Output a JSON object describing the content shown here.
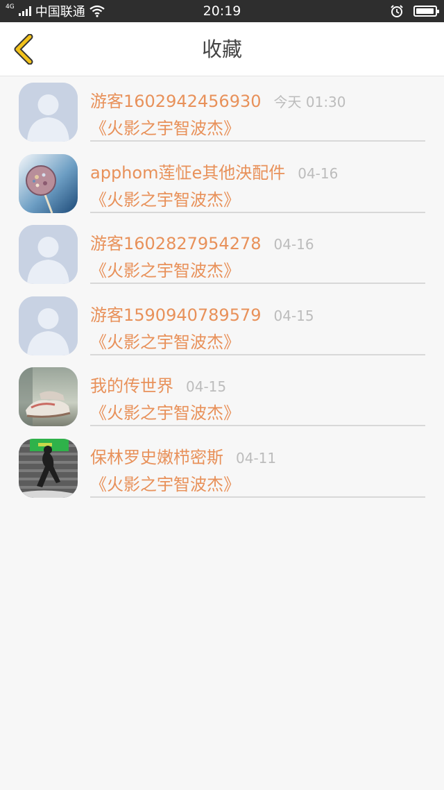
{
  "status_bar": {
    "network": "4G",
    "carrier": "中国联通",
    "time": "20:19",
    "battery_level": 0.95,
    "icons": [
      "signal-icon",
      "wifi-icon",
      "alarm-icon",
      "battery-icon"
    ]
  },
  "header": {
    "title": "收藏",
    "back_icon": "chevron-left-icon",
    "accent_color": "#f2b51a"
  },
  "colors": {
    "name_text": "#e8915a",
    "time_text": "#bcbcbc",
    "divider": "#d8d8d8",
    "background": "#f7f7f7"
  },
  "items": [
    {
      "username": "游客1602942456930",
      "time": "今天 01:30",
      "book": "《火影之宇智波杰》",
      "avatar": "default-avatar"
    },
    {
      "username": "apphom莲怔e其他泱配件",
      "time": "04-16",
      "book": "《火影之宇智波杰》",
      "avatar": "lollipop-photo"
    },
    {
      "username": "游客1602827954278",
      "time": "04-16",
      "book": "《火影之宇智波杰》",
      "avatar": "default-avatar"
    },
    {
      "username": "游客1590940789579",
      "time": "04-15",
      "book": "《火影之宇智波杰》",
      "avatar": "default-avatar"
    },
    {
      "username": "我的传世界",
      "time": "04-15",
      "book": "《火影之宇智波杰》",
      "avatar": "sneakers-photo"
    },
    {
      "username": "保林罗史嫩栉密斯",
      "time": "04-11",
      "book": "《火影之宇智波杰》",
      "avatar": "dancer-photo"
    }
  ]
}
